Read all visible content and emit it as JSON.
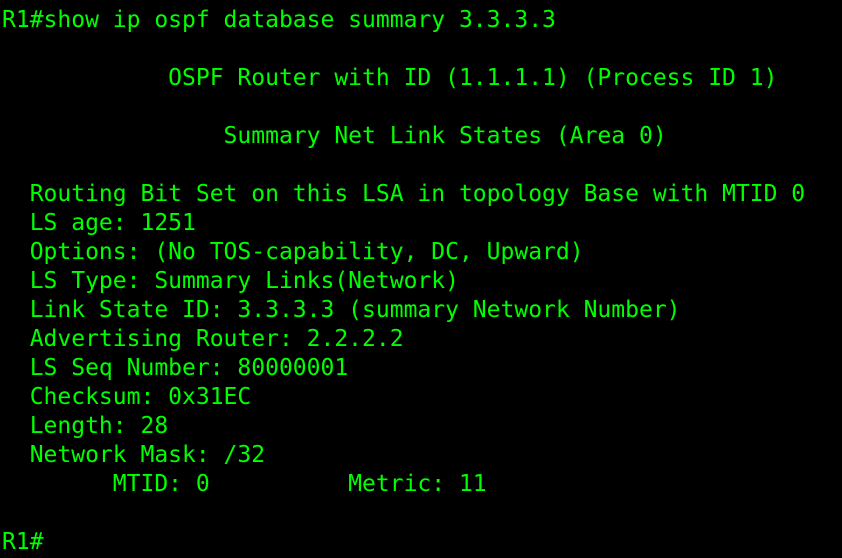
{
  "theme": {
    "background": "#000000",
    "foreground": "#00ff00"
  },
  "terminal": {
    "command_line": "R1#show ip ospf database summary 3.3.3.3",
    "header_router": "            OSPF Router with ID (1.1.1.1) (Process ID 1)",
    "header_section": "                Summary Net Link States (Area 0)",
    "routing_bit": "  Routing Bit Set on this LSA in topology Base with MTID 0",
    "ls_age": "  LS age: 1251",
    "options": "  Options: (No TOS-capability, DC, Upward)",
    "ls_type": "  LS Type: Summary Links(Network)",
    "link_state_id": "  Link State ID: 3.3.3.3 (summary Network Number)",
    "advertising_router": "  Advertising Router: 2.2.2.2",
    "ls_seq_number": "  LS Seq Number: 80000001",
    "checksum": "  Checksum: 0x31EC",
    "length": "  Length: 28",
    "network_mask": "  Network Mask: /32",
    "mtid_metric": "        MTID: 0          Metric: 11",
    "prompt": "R1#"
  }
}
